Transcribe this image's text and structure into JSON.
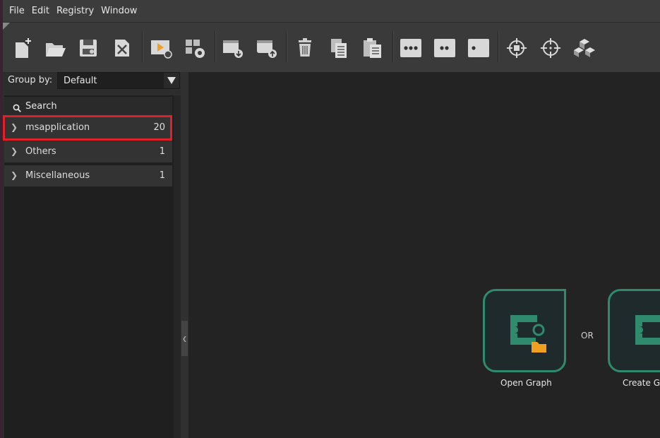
{
  "menu": {
    "items": [
      "File",
      "Edit",
      "Registry",
      "Window"
    ]
  },
  "toolbar": {
    "buttons": [
      {
        "icon": "new-file-icon"
      },
      {
        "icon": "open-folder-icon"
      },
      {
        "icon": "save-icon"
      },
      {
        "icon": "close-file-icon"
      },
      {
        "icon": "run-icon"
      },
      {
        "icon": "settings-icon"
      },
      {
        "icon": "download-icon"
      },
      {
        "icon": "upload-icon"
      },
      {
        "icon": "trash-icon"
      },
      {
        "icon": "copy-icon"
      },
      {
        "icon": "paste-icon"
      },
      {
        "icon": "dots-three-icon"
      },
      {
        "icon": "dots-two-icon"
      },
      {
        "icon": "dot-one-icon"
      },
      {
        "icon": "target-icon"
      },
      {
        "icon": "crosshair-icon"
      },
      {
        "icon": "cubes-icon"
      }
    ]
  },
  "sidebar": {
    "groupby_label": "Group by:",
    "groupby_value": "Default",
    "search_label": "Search",
    "items": [
      {
        "name": "msapplication",
        "count": "20"
      },
      {
        "name": "Others",
        "count": "1"
      },
      {
        "name": "Miscellaneous",
        "count": "1"
      }
    ]
  },
  "canvas": {
    "open_label": "Open Graph",
    "or_label": "OR",
    "create_label": "Create Gr"
  },
  "colors": {
    "accent_green": "#2f8a6e",
    "highlight_red": "#e0202a",
    "folder_orange": "#f0a020"
  }
}
